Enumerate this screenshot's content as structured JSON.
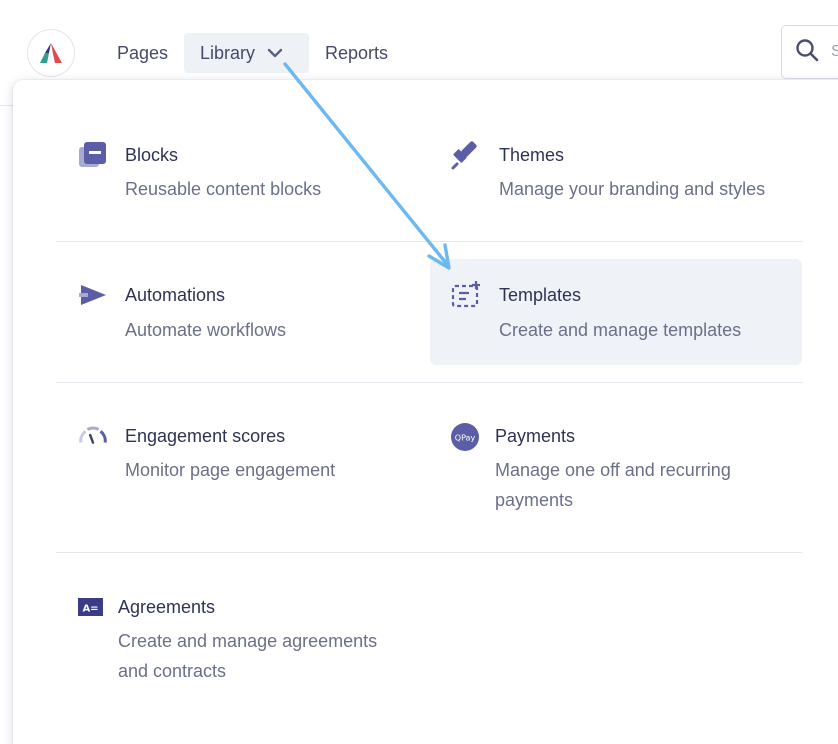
{
  "nav": {
    "items": [
      {
        "label": "Pages"
      },
      {
        "label": "Library"
      },
      {
        "label": "Reports"
      }
    ],
    "search_placeholder": "S"
  },
  "menu": {
    "items": [
      {
        "title": "Blocks",
        "description": "Reusable content blocks",
        "icon": "blocks-icon"
      },
      {
        "title": "Themes",
        "description": "Manage your branding and styles",
        "icon": "paintbrush-icon"
      },
      {
        "title": "Automations",
        "description": "Automate workflows",
        "icon": "automation-icon"
      },
      {
        "title": "Templates",
        "description": "Create and manage templates",
        "icon": "templates-icon",
        "highlighted": true
      },
      {
        "title": "Engagement scores",
        "description": "Monitor page engagement",
        "icon": "gauge-icon"
      },
      {
        "title": "Payments",
        "description": "Manage one off and recurring payments",
        "icon": "payments-icon"
      },
      {
        "title": "Agreements",
        "description": "Create and manage agreements and contracts",
        "icon": "agreements-icon"
      }
    ]
  },
  "payments_icon_text": "QPay",
  "agreements_icon_text": "A=",
  "colors": {
    "accent": "#5b5ea6",
    "arrow": "#6cb8f3",
    "highlight_bg": "#eff2f7",
    "nav_active_bg": "#eef1f6"
  }
}
